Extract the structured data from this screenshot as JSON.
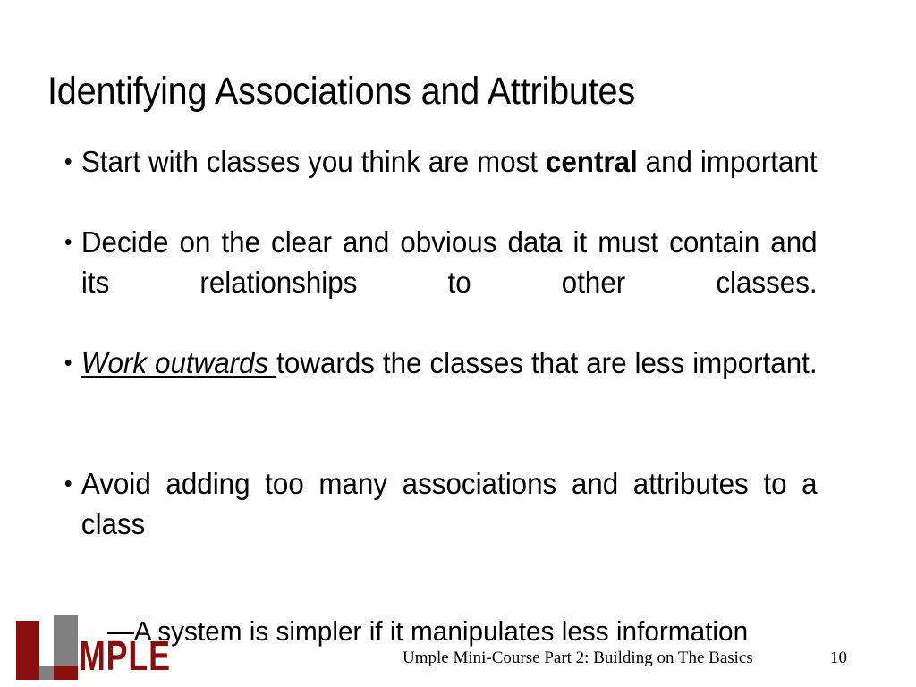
{
  "slide": {
    "title": "Identifying Associations and Attributes",
    "bullets": [
      {
        "id": "bullet-central",
        "level": 1,
        "marker": "bullet",
        "parts": [
          {
            "text": "Start with classes you think are most ",
            "style": "normal"
          },
          {
            "text": "central",
            "style": "bold"
          },
          {
            "text": " and important",
            "style": "normal"
          }
        ],
        "plain": "Start with classes you think are most central and important"
      },
      {
        "id": "bullet-decide",
        "level": 1,
        "marker": "bullet",
        "parts": [
          {
            "text": "Decide on the clear and obvious data it must contain and its relationships to other classes.",
            "style": "normal"
          }
        ],
        "plain": "Decide on the clear and obvious data it must contain and its relationships to other classes."
      },
      {
        "id": "bullet-work-outwards",
        "level": 1,
        "marker": "bullet",
        "parts": [
          {
            "text": "Work outwards ",
            "style": "italic-underline"
          },
          {
            "text": "towards the classes that are less important.",
            "style": "normal"
          }
        ],
        "plain": "Work outwards towards the classes that are less important."
      },
      {
        "id": "bullet-avoid",
        "level": 1,
        "marker": "bullet",
        "parts": [
          {
            "text": "Avoid adding too many associations and attributes to a class",
            "style": "normal"
          }
        ],
        "plain": "Avoid adding too many associations and attributes to a class"
      },
      {
        "id": "subbullet-simpler",
        "level": 2,
        "marker": "em-dash",
        "parts": [
          {
            "text": "—A system is simpler if it manipulates less information",
            "style": "normal"
          }
        ],
        "plain": "—A system is simpler if it manipulates less information"
      }
    ]
  },
  "footer": {
    "course": "Umple Mini-Course Part 2: Building on The Basics",
    "page_number": "10"
  },
  "logo": {
    "wordmark": "MPLE",
    "full_name": "Umple",
    "red": "#8b0e0e",
    "gray": "#808080"
  },
  "colors": {
    "background": "#ffffff",
    "text": "#000000",
    "brand_red": "#8b0e0e",
    "brand_gray": "#808080"
  }
}
